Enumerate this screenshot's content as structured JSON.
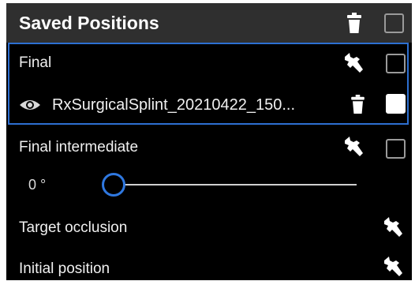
{
  "panel": {
    "title": "Saved Positions"
  },
  "items": [
    {
      "label": "Final",
      "checked": false,
      "selected": true,
      "sub_item": {
        "label": "RxSurgicalSplint_20210422_150...",
        "visible": true,
        "checked": true
      }
    },
    {
      "label": "Final intermediate",
      "checked": false,
      "slider": {
        "value_label": "0 °",
        "value": 0
      }
    },
    {
      "label": "Target occlusion"
    },
    {
      "label": "Initial position"
    }
  ],
  "colors": {
    "panel_bg": "#000000",
    "header_bg": "#2f2f2f",
    "selection_border": "#2d6fd1",
    "slider_thumb": "#2f78e0",
    "text": "#f0f0f0"
  },
  "icons": {
    "delete": "trash-icon",
    "settings": "wrench-icon",
    "visibility": "eye-icon"
  }
}
